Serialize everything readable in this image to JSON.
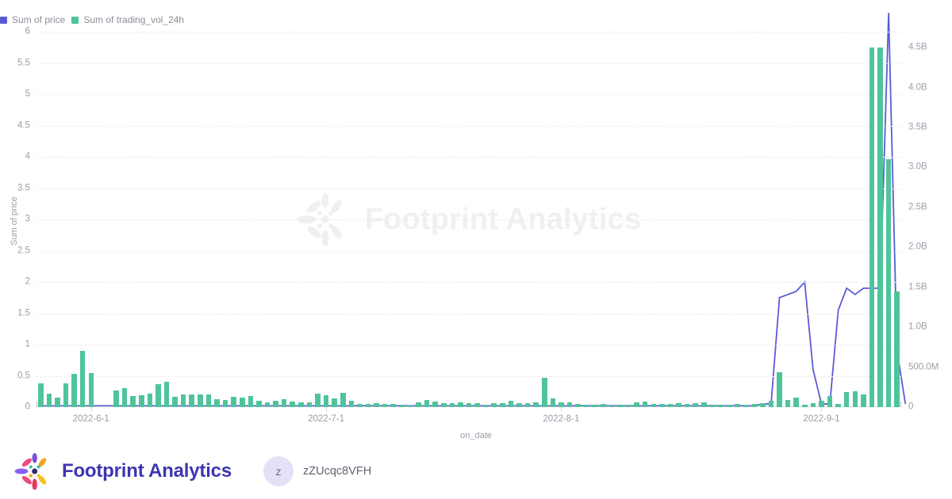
{
  "legend": {
    "items": [
      {
        "label": "Sum of price",
        "color": "#5a5ad6",
        "icon": "square-swatch-icon"
      },
      {
        "label": "Sum of trading_vol_24h",
        "color": "#4fc49b",
        "icon": "square-swatch-icon"
      }
    ]
  },
  "footer": {
    "brand_name": "Footprint Analytics",
    "logo_icon": "footprint-petal-logo-icon",
    "avatar_initial": "z",
    "user_name": "zZUcqc8VFH"
  },
  "watermark": {
    "text": "Footprint Analytics",
    "logo_icon": "footprint-petal-logo-icon"
  },
  "chart_data": {
    "type": "bar",
    "title": "",
    "subtitle": "",
    "xlabel": "on_date",
    "ylabel": "Sum of price",
    "y2label": "",
    "grid": true,
    "legend_position": "top-left",
    "x_tick_labels": [
      "2022-6-1",
      "2022-7-1",
      "2022-8-1",
      "2022-9-1"
    ],
    "x_tick_positions": [
      6,
      34,
      62,
      93
    ],
    "y_left_ticks": [
      "0",
      "0.5",
      "1",
      "1.5",
      "2",
      "2.5",
      "3",
      "3.5",
      "4",
      "4.5",
      "5",
      "5.5",
      "6"
    ],
    "y_left_values": [
      0,
      0.5,
      1,
      1.5,
      2,
      2.5,
      3,
      3.5,
      4,
      4.5,
      5,
      5.5,
      6
    ],
    "ylim": [
      0,
      6
    ],
    "y_right_ticks": [
      "0",
      "500.0M",
      "1.0B",
      "1.5B",
      "2.0B",
      "2.5B",
      "3.0B",
      "3.5B",
      "4.0B",
      "4.5B"
    ],
    "y_right_values": [
      0,
      500000000,
      1000000000,
      1500000000,
      2000000000,
      2500000000,
      3000000000,
      3500000000,
      4000000000,
      4500000000
    ],
    "y2lim": [
      0,
      4700000000
    ],
    "series": [
      {
        "name": "Sum of trading_vol_24h",
        "type": "bar",
        "color": "#4fc49b",
        "axis": "right",
        "values": [
          300000000,
          170000000,
          120000000,
          300000000,
          420000000,
          700000000,
          430000000,
          0,
          0,
          210000000,
          240000000,
          140000000,
          150000000,
          170000000,
          290000000,
          320000000,
          130000000,
          160000000,
          160000000,
          160000000,
          160000000,
          95000000,
          90000000,
          130000000,
          120000000,
          140000000,
          75000000,
          60000000,
          80000000,
          95000000,
          65000000,
          60000000,
          55000000,
          170000000,
          145000000,
          110000000,
          175000000,
          80000000,
          40000000,
          40000000,
          45000000,
          40000000,
          35000000,
          25000000,
          20000000,
          55000000,
          90000000,
          70000000,
          50000000,
          45000000,
          55000000,
          45000000,
          45000000,
          30000000,
          45000000,
          45000000,
          75000000,
          50000000,
          45000000,
          60000000,
          370000000,
          110000000,
          55000000,
          60000000,
          40000000,
          30000000,
          25000000,
          35000000,
          25000000,
          25000000,
          30000000,
          60000000,
          70000000,
          40000000,
          35000000,
          35000000,
          45000000,
          40000000,
          50000000,
          60000000,
          30000000,
          30000000,
          25000000,
          40000000,
          30000000,
          35000000,
          50000000,
          75000000,
          440000000,
          90000000,
          120000000,
          25000000,
          45000000,
          75000000,
          140000000,
          35000000,
          190000000,
          200000000,
          160000000,
          4500000000,
          4500000000,
          3100000000,
          1450000000
        ]
      },
      {
        "name": "Sum of price",
        "type": "line",
        "color": "#5a5ad6",
        "axis": "left",
        "values": [
          0.02,
          0.02,
          0.02,
          0.02,
          0.02,
          0.02,
          0.02,
          0.02,
          0.02,
          0.02,
          0.02,
          0.02,
          0.02,
          0.02,
          0.02,
          0.02,
          0.02,
          0.02,
          0.02,
          0.02,
          0.02,
          0.02,
          0.02,
          0.02,
          0.02,
          0.02,
          0.02,
          0.02,
          0.02,
          0.02,
          0.02,
          0.02,
          0.02,
          0.02,
          0.02,
          0.02,
          0.02,
          0.02,
          0.02,
          0.02,
          0.02,
          0.02,
          0.02,
          0.02,
          0.02,
          0.02,
          0.02,
          0.02,
          0.02,
          0.02,
          0.02,
          0.02,
          0.02,
          0.02,
          0.02,
          0.02,
          0.02,
          0.02,
          0.02,
          0.02,
          0.02,
          0.02,
          0.02,
          0.02,
          0.02,
          0.02,
          0.02,
          0.02,
          0.02,
          0.02,
          0.02,
          0.02,
          0.02,
          0.02,
          0.02,
          0.02,
          0.02,
          0.02,
          0.02,
          0.02,
          0.02,
          0.02,
          0.02,
          0.02,
          0.02,
          0.02,
          0.05,
          0.05,
          1.75,
          1.8,
          1.85,
          2.0,
          0.6,
          0.05,
          0.05,
          1.55,
          1.9,
          1.8,
          1.9,
          1.9,
          1.9,
          6.3,
          0.9,
          0.05
        ]
      }
    ]
  }
}
